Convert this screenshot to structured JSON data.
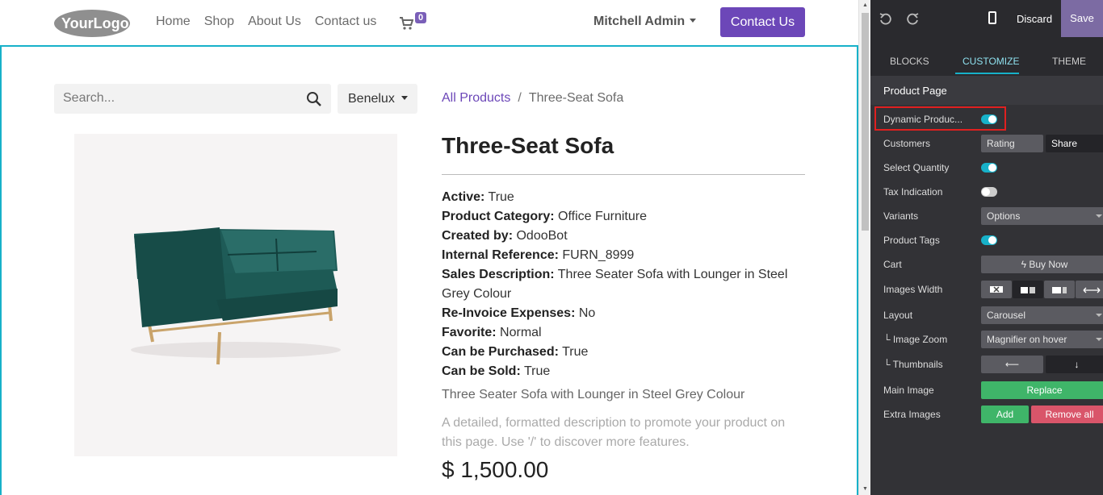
{
  "header": {
    "logo_text": "YourLogo",
    "nav": [
      "Home",
      "Shop",
      "About Us",
      "Contact us"
    ],
    "cart_count": "0",
    "user_name": "Mitchell Admin",
    "cta_label": "Contact Us"
  },
  "shop": {
    "search_placeholder": "Search...",
    "region": "Benelux",
    "breadcrumb": {
      "parent": "All Products",
      "sep": "/",
      "current": "Three-Seat Sofa"
    }
  },
  "product": {
    "title": "Three-Seat Sofa",
    "attributes": [
      {
        "key": "Active:",
        "value": "True"
      },
      {
        "key": "Product Category:",
        "value": "Office Furniture"
      },
      {
        "key": "Created by:",
        "value": "OdooBot"
      },
      {
        "key": "Internal Reference:",
        "value": "FURN_8999"
      },
      {
        "key": "Sales Description:",
        "value": "Three Seater Sofa with Lounger in Steel Grey Colour"
      },
      {
        "key": "Re-Invoice Expenses:",
        "value": "No"
      },
      {
        "key": "Favorite:",
        "value": "Normal"
      },
      {
        "key": "Can be Purchased:",
        "value": "True"
      },
      {
        "key": "Can be Sold:",
        "value": "True"
      }
    ],
    "short_description": "Three Seater Sofa with Lounger in Steel Grey Colour",
    "long_description": "A detailed, formatted description to promote your product on this page. Use '/' to discover more features.",
    "price": "$ 1,500.00"
  },
  "panel": {
    "discard_label": "Discard",
    "save_label": "Save",
    "tabs": [
      "BLOCKS",
      "CUSTOMIZE",
      "THEME"
    ],
    "section_title": "Product Page",
    "rows": {
      "dynamic_product": "Dynamic Produc...",
      "customers": "Customers",
      "rating": "Rating",
      "share": "Share",
      "select_quantity": "Select Quantity",
      "tax_indication": "Tax Indication",
      "variants": "Variants",
      "variants_value": "Options",
      "product_tags": "Product Tags",
      "cart": "Cart",
      "buy_now": "Buy Now",
      "images_width": "Images Width",
      "layout": "Layout",
      "layout_value": "Carousel",
      "image_zoom": "└ Image Zoom",
      "image_zoom_value": "Magnifier on hover",
      "thumbnails": "└ Thumbnails",
      "main_image": "Main Image",
      "replace": "Replace",
      "extra_images": "Extra Images",
      "add": "Add",
      "remove_all": "Remove all"
    }
  },
  "colors": {
    "accent": "#6c47b8",
    "edit_border": "#17b1c9",
    "panel_bg": "#323236",
    "highlight": "#e02020"
  }
}
